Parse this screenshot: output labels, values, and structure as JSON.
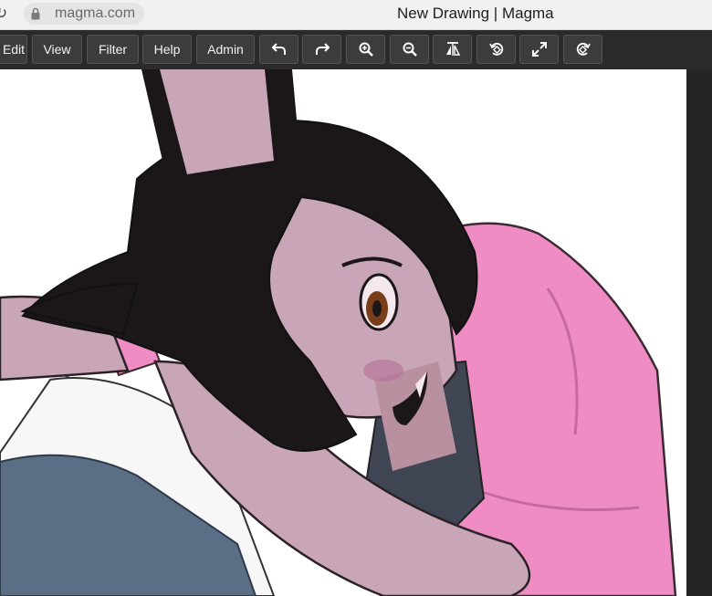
{
  "browser": {
    "url": "magma.com",
    "title": "New Drawing | Magma"
  },
  "toolbar": {
    "menus": [
      {
        "label": "Edit"
      },
      {
        "label": "View"
      },
      {
        "label": "Filter"
      },
      {
        "label": "Help"
      },
      {
        "label": "Admin"
      }
    ],
    "tools": [
      {
        "icon": "undo-icon"
      },
      {
        "icon": "redo-icon"
      },
      {
        "icon": "zoom-in-icon"
      },
      {
        "icon": "zoom-out-icon"
      },
      {
        "icon": "flip-icon"
      },
      {
        "icon": "rotate-left-icon"
      },
      {
        "icon": "fullscreen-icon"
      },
      {
        "icon": "rotate-right-icon"
      }
    ]
  },
  "colors": {
    "toolbar_bg": "#2a2a2a",
    "button_bg": "#3c3c3c",
    "canvas_bg": "#ffffff",
    "skin": "#c9a5b8",
    "hair": "#1b1718",
    "hoodie": "#f08cc4",
    "shirt": "#3f4552",
    "jeans": "#5a6e85"
  },
  "canvas": {
    "subject": "drawing-canvas"
  }
}
